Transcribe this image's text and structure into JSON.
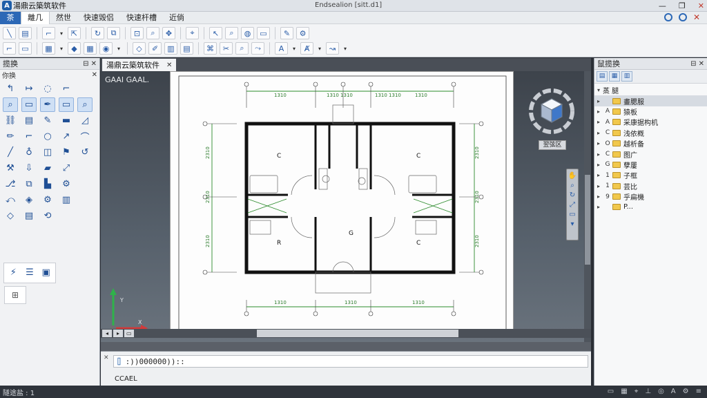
{
  "titlebar": {
    "app_title": "湯鼎云築筑软件",
    "doc_title": "Endsealion [sitt.d1]",
    "minimize": "—",
    "maximize": "❐",
    "close": "✕"
  },
  "menubar": {
    "tabs": [
      "茶",
      "離几",
      "然世",
      "快速毁侣",
      "快速杆槽",
      "近倘"
    ]
  },
  "left_panel": {
    "title": "揽换",
    "pin": "⊟ ✕",
    "sub_title": "你换",
    "sub_ctrl": "✕"
  },
  "doc": {
    "tab_label": "湯鼎云築筑软件",
    "tab_close": "✕",
    "view_label": "GAAI GAAL."
  },
  "viewcube": {
    "label": "翌弦区"
  },
  "drawing": {
    "room_labels": [
      "C",
      "C",
      "G",
      "R",
      "C"
    ],
    "dims_top": [
      "1310",
      "1310 1310",
      "1310 1310",
      "1310"
    ],
    "dims_bottom": [
      "1310",
      "1310",
      "1310"
    ],
    "dims_left": [
      "2310",
      "2310",
      "2310"
    ],
    "dims_right": [
      "2310",
      "2310",
      "2310"
    ]
  },
  "ucs": {
    "y_label": "Y",
    "x_label": "X"
  },
  "command": {
    "input": ":))000000))::",
    "prompt": "CCAEL"
  },
  "right_panel": {
    "title": "鼠揽换",
    "pin": "⊟ ✕",
    "root": "蒸 腿",
    "items": [
      {
        "letter": "",
        "label": "畫腮服"
      },
      {
        "letter": "A",
        "label": "猿板"
      },
      {
        "letter": "A",
        "label": "采康据构机"
      },
      {
        "letter": "C",
        "label": "浅依概"
      },
      {
        "letter": "O",
        "label": "越析备"
      },
      {
        "letter": "C",
        "label": "图广"
      },
      {
        "letter": "G",
        "label": "孽屢"
      },
      {
        "letter": "1",
        "label": "子框"
      },
      {
        "letter": "1",
        "label": "芸比"
      },
      {
        "letter": "9",
        "label": "乎扁機"
      },
      {
        "letter": "P",
        "label": "P..."
      }
    ]
  },
  "statusbar": {
    "text": "隧途盐 : 1"
  }
}
